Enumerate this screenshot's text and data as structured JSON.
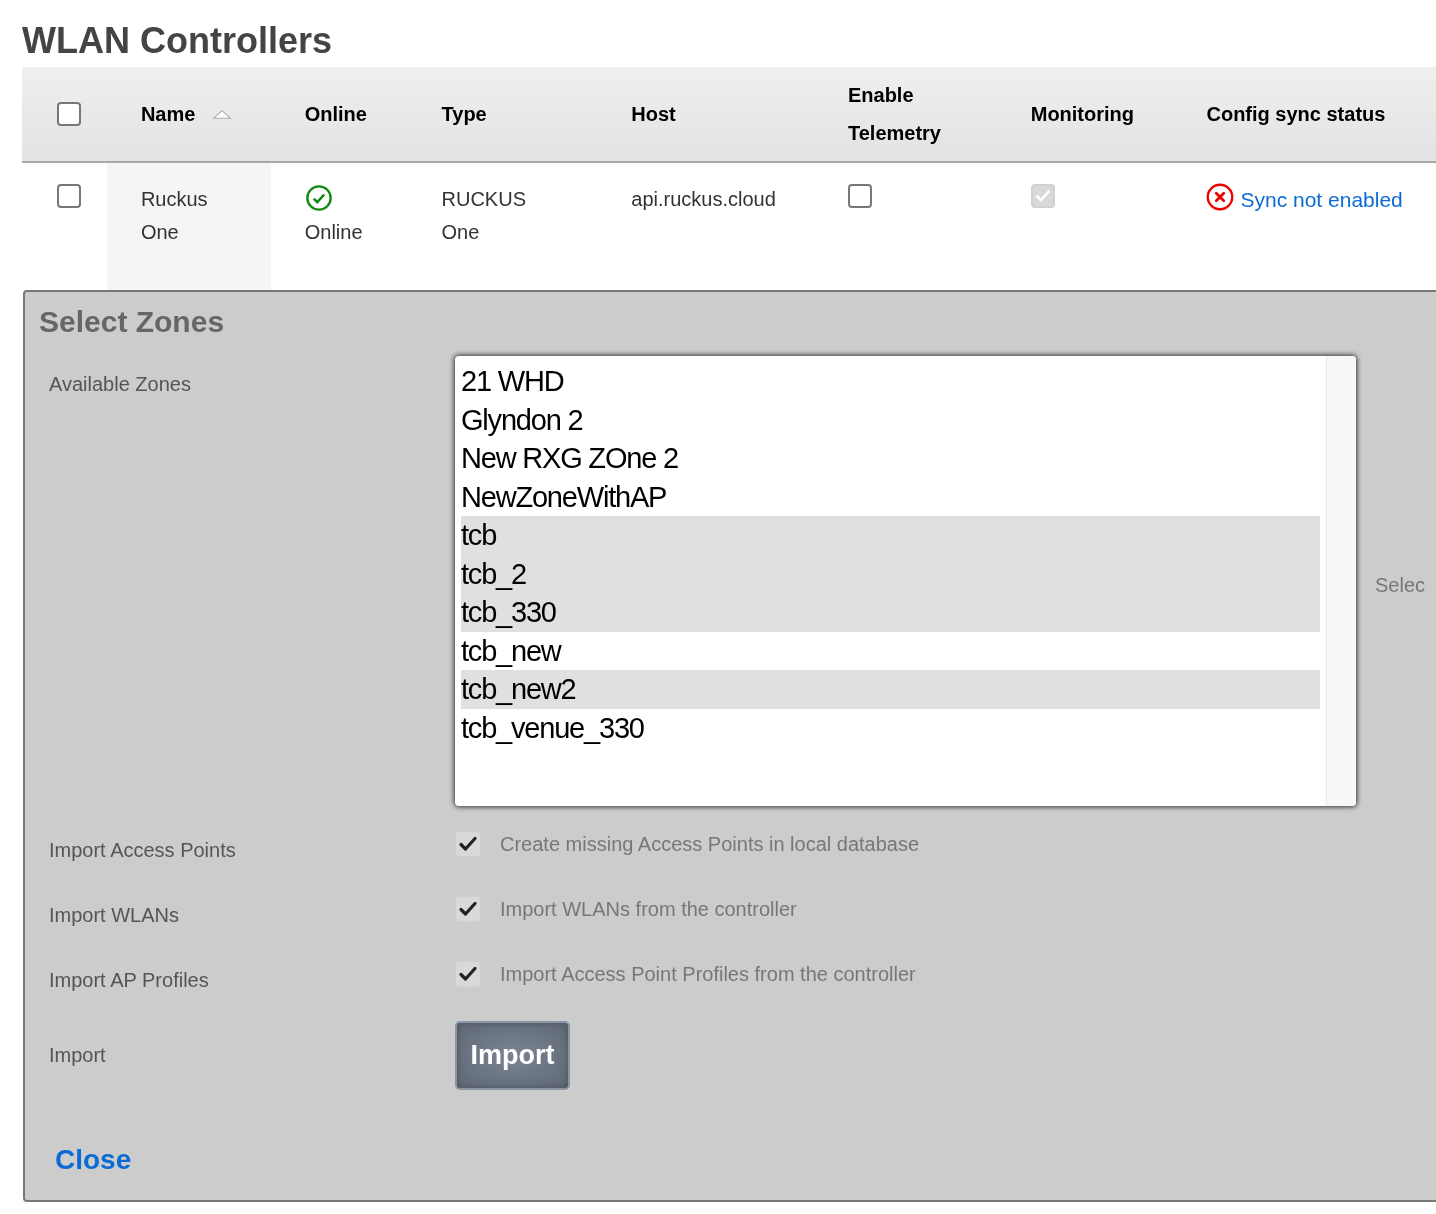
{
  "page_title": "WLAN Controllers",
  "table": {
    "select_all": {
      "checked": false
    },
    "columns": [
      {
        "label": "Name",
        "sorted": true
      },
      {
        "label": "Online",
        "sorted": false
      },
      {
        "label": "Type",
        "sorted": false
      },
      {
        "label": "Host",
        "sorted": false
      },
      {
        "label": "Enable Telemetry",
        "sorted": false
      },
      {
        "label": "Monitoring",
        "sorted": false
      },
      {
        "label": "Config sync status",
        "sorted": false
      }
    ],
    "rows": [
      {
        "selected": false,
        "name": "Ruckus One",
        "online": {
          "kind": "online",
          "label": "Online"
        },
        "type": "RUCKUS One",
        "host": "api.ruckus.cloud",
        "enable_telemetry": {
          "checked": false,
          "disabled": false
        },
        "monitoring": {
          "checked": true,
          "disabled": true
        },
        "config_sync": {
          "kind": "error",
          "label": "Sync not enabled"
        }
      }
    ]
  },
  "dialog": {
    "title": "Select Zones",
    "available_zones": {
      "label": "Available Zones",
      "items": [
        {
          "label": "21 WHD",
          "selected": false
        },
        {
          "label": "Glyndon 2",
          "selected": false
        },
        {
          "label": "New RXG ZOne 2",
          "selected": false
        },
        {
          "label": "NewZoneWithAP",
          "selected": false
        },
        {
          "label": "tcb",
          "selected": true
        },
        {
          "label": "tcb_2",
          "selected": true
        },
        {
          "label": "tcb_330",
          "selected": true
        },
        {
          "label": "tcb_new",
          "selected": false
        },
        {
          "label": "tcb_new2",
          "selected": true
        },
        {
          "label": "tcb_venue_330",
          "selected": false
        }
      ]
    },
    "side_text": "Selec",
    "options": [
      {
        "label": "Import Access Points",
        "text": "Create missing Access Points in local database",
        "checked": true
      },
      {
        "label": "Import WLANs",
        "text": "Import WLANs from the controller",
        "checked": true
      },
      {
        "label": "Import AP Profiles",
        "text": "Import Access Point Profiles from the controller",
        "checked": true
      }
    ],
    "import": {
      "label": "Import",
      "button": "Import"
    },
    "close": "Close"
  }
}
